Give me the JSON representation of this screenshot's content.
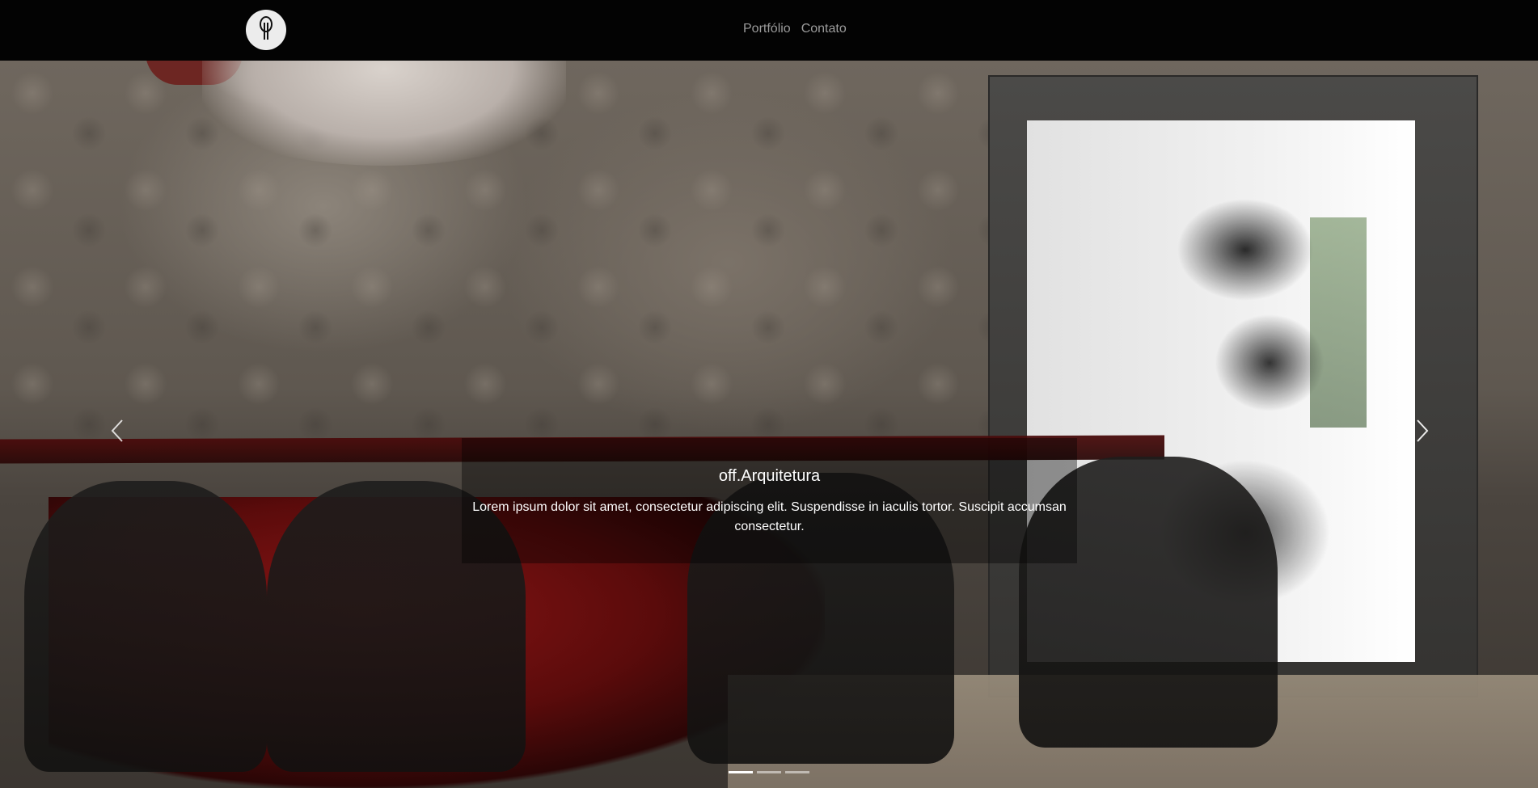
{
  "navbar": {
    "brand_icon": "tree-logo-icon",
    "links": [
      {
        "label": "Portfólio"
      },
      {
        "label": "Contato"
      }
    ]
  },
  "carousel": {
    "active_index": 0,
    "slides": [
      {
        "title": "off.Arquitetura",
        "text": "Lorem ipsum dolor sit amet, consectetur adipiscing elit. Suspendisse in iaculis tortor. Suscipit accumsan consectetur."
      }
    ],
    "prev_icon": "chevron-left-icon",
    "next_icon": "chevron-right-icon",
    "indicator_count": 3
  },
  "colors": {
    "navbar_bg": "#030303",
    "nav_link": "#9b9b9b",
    "caption_text": "#ffffff"
  }
}
